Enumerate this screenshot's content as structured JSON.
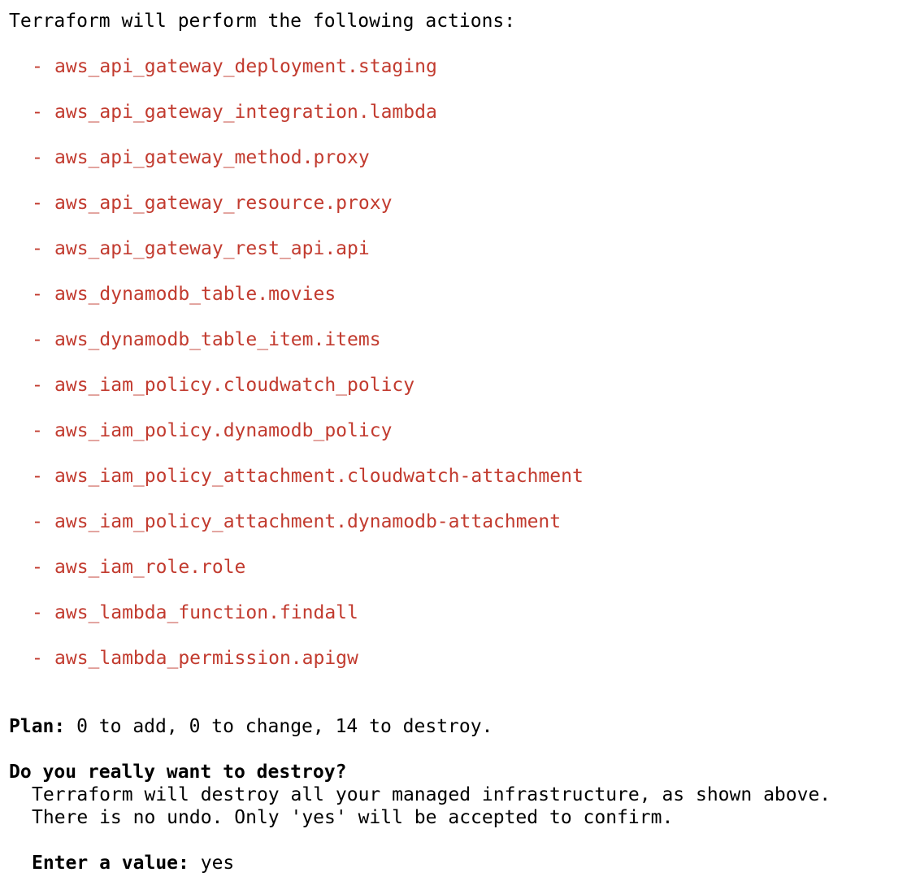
{
  "header": "Terraform will perform the following actions:",
  "resources": {
    "dash": "-",
    "items": [
      "aws_api_gateway_deployment.staging",
      "aws_api_gateway_integration.lambda",
      "aws_api_gateway_method.proxy",
      "aws_api_gateway_resource.proxy",
      "aws_api_gateway_rest_api.api",
      "aws_dynamodb_table.movies",
      "aws_dynamodb_table_item.items",
      "aws_iam_policy.cloudwatch_policy",
      "aws_iam_policy.dynamodb_policy",
      "aws_iam_policy_attachment.cloudwatch-attachment",
      "aws_iam_policy_attachment.dynamodb-attachment",
      "aws_iam_role.role",
      "aws_lambda_function.findall",
      "aws_lambda_permission.apigw"
    ]
  },
  "plan": {
    "label": "Plan:",
    "summary": " 0 to add, 0 to change, 14 to destroy."
  },
  "prompt": {
    "question": "Do you really want to destroy?",
    "warning_line_1": "Terraform will destroy all your managed infrastructure, as shown above.",
    "warning_line_2": "There is no undo. Only 'yes' will be accepted to confirm.",
    "input_label": "Enter a value:",
    "input_value": " yes"
  },
  "colors": {
    "resource_red": "#c23b2f",
    "text": "#000000",
    "background": "#ffffff"
  }
}
